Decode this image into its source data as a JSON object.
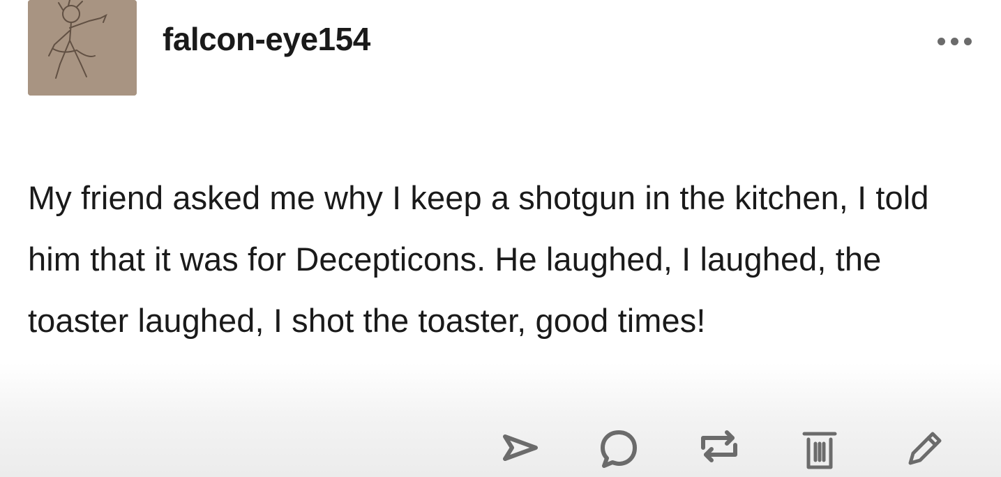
{
  "post": {
    "username": "falcon-eye154",
    "body": "My friend asked me why I keep a shotgun in the kitchen, I told him that it was for Decepticons. He laughed, I laughed, the toaster laughed, I shot the toaster, good times!"
  },
  "header": {
    "avatar_icon": "sketch-avatar",
    "more_icon": "more-options-icon"
  },
  "actions": {
    "icons": [
      "share-icon",
      "reply-icon",
      "reblog-icon",
      "delete-icon",
      "edit-icon"
    ]
  },
  "colors": {
    "text": "#1a1a1a",
    "icon": "#6b6b6b",
    "avatar_bg": "#a89482"
  }
}
